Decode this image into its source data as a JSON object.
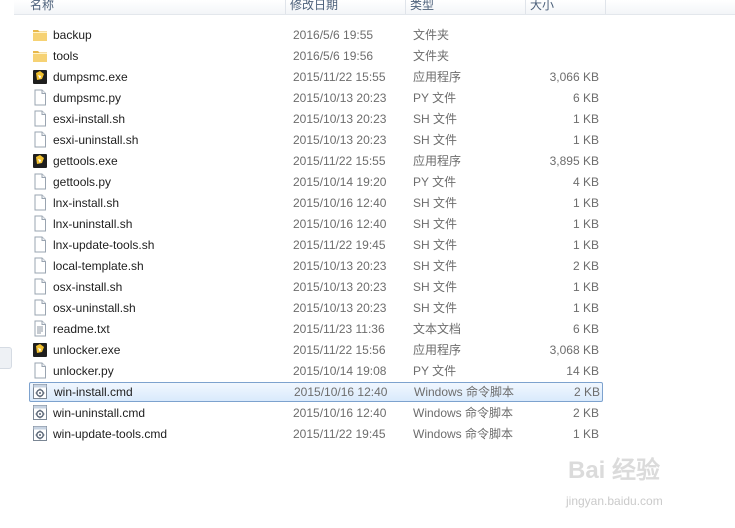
{
  "columns": {
    "name": "名称",
    "date": "修改日期",
    "type": "类型",
    "size": "大小"
  },
  "files": [
    {
      "name": "backup",
      "date": "2016/5/6 19:55",
      "type": "文件夹",
      "size": "",
      "icon": "folder-icon"
    },
    {
      "name": "tools",
      "date": "2016/5/6 19:56",
      "type": "文件夹",
      "size": "",
      "icon": "folder-icon"
    },
    {
      "name": "dumpsmc.exe",
      "date": "2015/11/22 15:55",
      "type": "应用程序",
      "size": "3,066 KB",
      "icon": "exe-icon"
    },
    {
      "name": "dumpsmc.py",
      "date": "2015/10/13 20:23",
      "type": "PY 文件",
      "size": "6 KB",
      "icon": "file-icon"
    },
    {
      "name": "esxi-install.sh",
      "date": "2015/10/13 20:23",
      "type": "SH 文件",
      "size": "1 KB",
      "icon": "file-icon"
    },
    {
      "name": "esxi-uninstall.sh",
      "date": "2015/10/13 20:23",
      "type": "SH 文件",
      "size": "1 KB",
      "icon": "file-icon"
    },
    {
      "name": "gettools.exe",
      "date": "2015/11/22 15:55",
      "type": "应用程序",
      "size": "3,895 KB",
      "icon": "exe-icon"
    },
    {
      "name": "gettools.py",
      "date": "2015/10/14 19:20",
      "type": "PY 文件",
      "size": "4 KB",
      "icon": "file-icon"
    },
    {
      "name": "lnx-install.sh",
      "date": "2015/10/16 12:40",
      "type": "SH 文件",
      "size": "1 KB",
      "icon": "file-icon"
    },
    {
      "name": "lnx-uninstall.sh",
      "date": "2015/10/16 12:40",
      "type": "SH 文件",
      "size": "1 KB",
      "icon": "file-icon"
    },
    {
      "name": "lnx-update-tools.sh",
      "date": "2015/11/22 19:45",
      "type": "SH 文件",
      "size": "1 KB",
      "icon": "file-icon"
    },
    {
      "name": "local-template.sh",
      "date": "2015/10/13 20:23",
      "type": "SH 文件",
      "size": "2 KB",
      "icon": "file-icon"
    },
    {
      "name": "osx-install.sh",
      "date": "2015/10/13 20:23",
      "type": "SH 文件",
      "size": "1 KB",
      "icon": "file-icon"
    },
    {
      "name": "osx-uninstall.sh",
      "date": "2015/10/13 20:23",
      "type": "SH 文件",
      "size": "1 KB",
      "icon": "file-icon"
    },
    {
      "name": "readme.txt",
      "date": "2015/11/23 11:36",
      "type": "文本文档",
      "size": "6 KB",
      "icon": "text-file-icon"
    },
    {
      "name": "unlocker.exe",
      "date": "2015/11/22 15:56",
      "type": "应用程序",
      "size": "3,068 KB",
      "icon": "exe-icon"
    },
    {
      "name": "unlocker.py",
      "date": "2015/10/14 19:08",
      "type": "PY 文件",
      "size": "14 KB",
      "icon": "file-icon"
    },
    {
      "name": "win-install.cmd",
      "date": "2015/10/16 12:40",
      "type": "Windows 命令脚本",
      "size": "2 KB",
      "icon": "cmd-script-icon",
      "selected": true
    },
    {
      "name": "win-uninstall.cmd",
      "date": "2015/10/16 12:40",
      "type": "Windows 命令脚本",
      "size": "2 KB",
      "icon": "cmd-script-icon"
    },
    {
      "name": "win-update-tools.cmd",
      "date": "2015/11/22 19:45",
      "type": "Windows 命令脚本",
      "size": "1 KB",
      "icon": "cmd-script-icon"
    }
  ],
  "watermark": {
    "brand": "Bai 经验",
    "url": "jingyan.baidu.com"
  },
  "colors": {
    "selection_border": "#7da2ce",
    "selection_fill": "#d9eafc",
    "folder": "#e8b84a",
    "header_text": "#4c607a"
  }
}
